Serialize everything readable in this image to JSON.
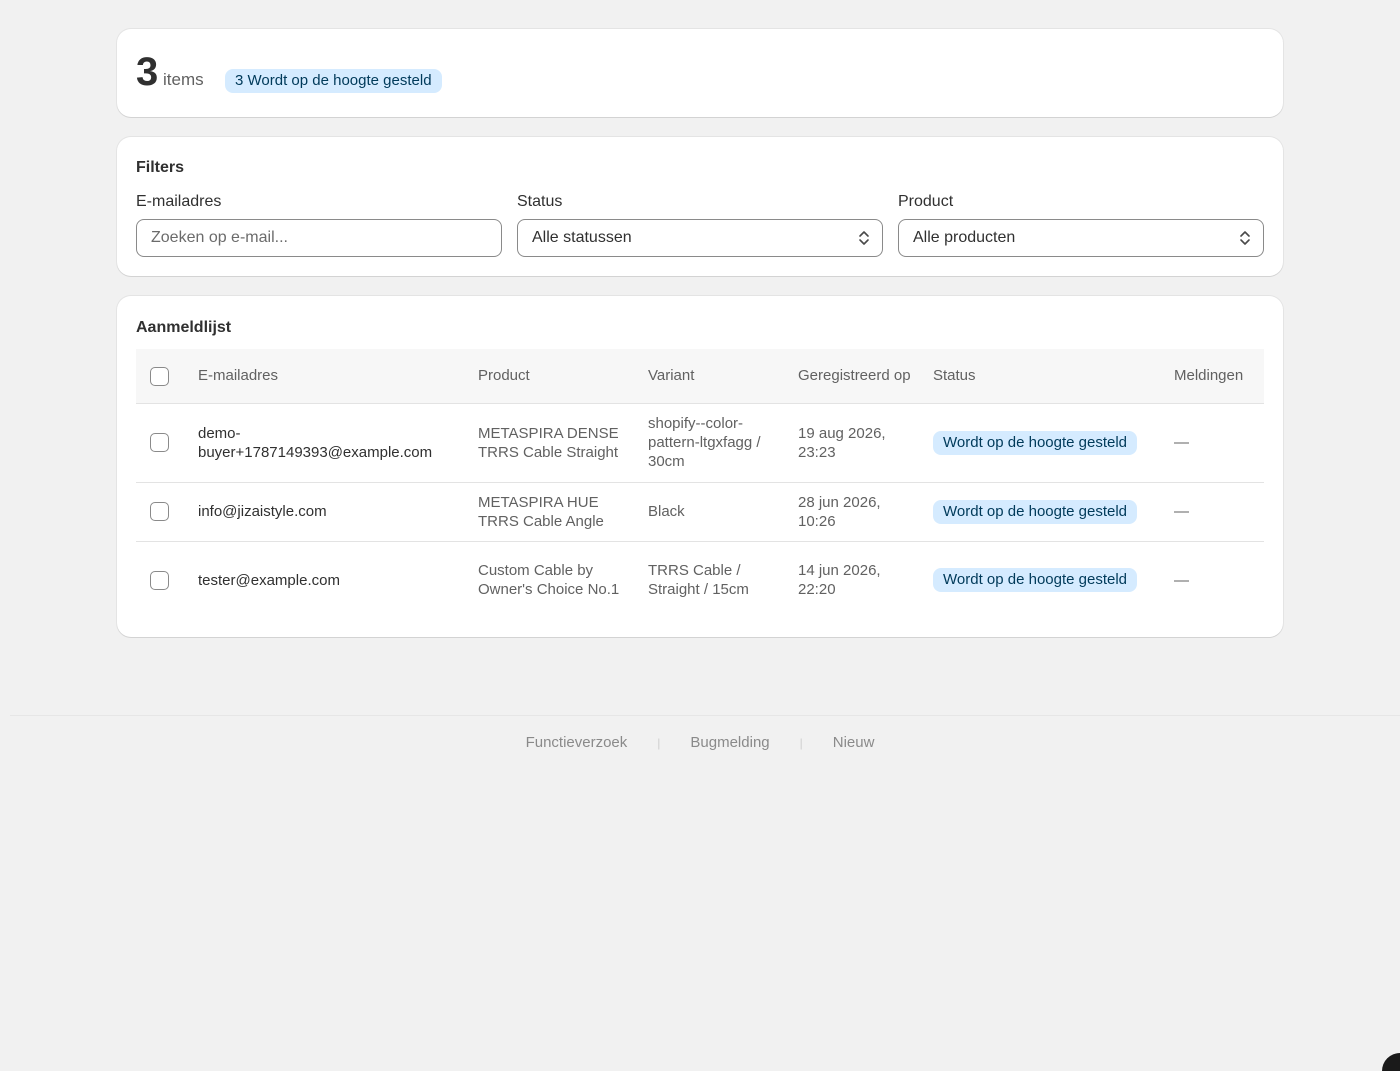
{
  "summary": {
    "count": "3",
    "count_label": "items",
    "badge": "3 Wordt op de hoogte gesteld"
  },
  "filters": {
    "title": "Filters",
    "email": {
      "label": "E-mailadres",
      "placeholder": "Zoeken op e-mail..."
    },
    "status": {
      "label": "Status",
      "selected": "Alle statussen"
    },
    "product": {
      "label": "Product",
      "selected": "Alle producten"
    }
  },
  "list": {
    "title": "Aanmeldlijst",
    "columns": {
      "email": "E-mailadres",
      "product": "Product",
      "variant": "Variant",
      "registered": "Geregistreerd op",
      "status": "Status",
      "notifications": "Meldingen"
    },
    "rows": [
      {
        "email": "demo-buyer+1787149393@example.com",
        "product": "METASPIRA DENSE TRRS Cable Straight",
        "variant": "shopify--color-pattern-ltgxfagg / 30cm",
        "registered": "19 aug 2026, 23:23",
        "status": "Wordt op de hoogte gesteld",
        "notifications": "—"
      },
      {
        "email": "info@jizaistyle.com",
        "product": "METASPIRA HUE TRRS Cable Angle",
        "variant": "Black",
        "registered": "28 jun 2026, 10:26",
        "status": "Wordt op de hoogte gesteld",
        "notifications": "—"
      },
      {
        "email": "tester@example.com",
        "product": "Custom Cable by Owner's Choice No.1",
        "variant": "TRRS Cable / Straight / 15cm",
        "registered": "14 jun 2026, 22:20",
        "status": "Wordt op de hoogte gesteld",
        "notifications": "—"
      }
    ]
  },
  "footer": {
    "links": [
      "Functieverzoek",
      "Bugmelding",
      "Nieuw"
    ]
  },
  "colors": {
    "background": "#f1f1f1",
    "badge_bg": "#d5ebff",
    "badge_text": "#003a5a"
  }
}
